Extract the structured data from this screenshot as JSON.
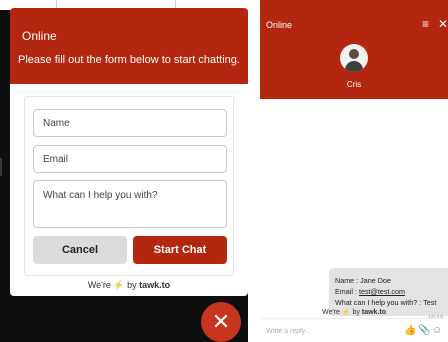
{
  "left_widget": {
    "status": "Online",
    "subtitle": "Please fill out the form below to start chatting.",
    "form": {
      "name_placeholder": "Name",
      "email_placeholder": "Email",
      "message_placeholder": "What can I help you with?"
    },
    "cancel_label": "Cancel",
    "start_label": "Start Chat",
    "powered": {
      "prefix": "We're",
      "bolt": "⚡",
      "mid": "by",
      "brand": "tawk.to"
    },
    "close_glyph": "✕"
  },
  "right_widget": {
    "status": "Online",
    "menu_glyph": "≡",
    "close_glyph": "✕",
    "agent_name": "Cris",
    "message": {
      "line1": "Name : Jane Doe",
      "email_label": "Email : ",
      "email_value": "test@test.com",
      "line3": "What can I help you with? : Test",
      "time": "10:13"
    },
    "powered": {
      "prefix": "We're",
      "bolt": "⚡",
      "mid": "by",
      "brand": "tawk.to"
    },
    "reply_placeholder": "Write a reply...",
    "icons": {
      "like": "👍",
      "attach": "📎",
      "emoji": "☺"
    }
  },
  "colors": {
    "brand": "#b3260f",
    "fab": "#c7351e",
    "bubble": "#e3e3e3"
  }
}
